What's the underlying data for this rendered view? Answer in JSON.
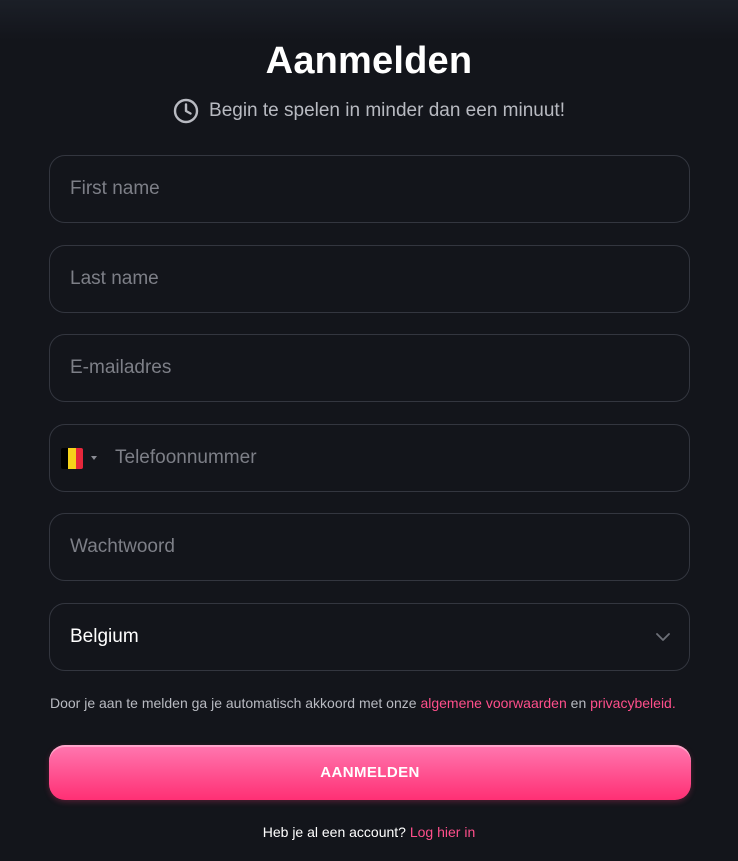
{
  "header": {
    "title": "Aanmelden",
    "subtitle": "Begin te spelen in minder dan een minuut!",
    "subtitle_icon": "clock-icon"
  },
  "form": {
    "first_name": {
      "placeholder": "First name",
      "value": ""
    },
    "last_name": {
      "placeholder": "Last name",
      "value": ""
    },
    "email": {
      "placeholder": "E-mailadres",
      "value": ""
    },
    "phone": {
      "placeholder": "Telefoonnummer",
      "value": "",
      "country_flag": "belgium-flag-icon",
      "flag_colors": [
        "#000000",
        "#f6d21a",
        "#e6273b"
      ]
    },
    "password": {
      "placeholder": "Wachtwoord",
      "value": ""
    },
    "country": {
      "selected": "Belgium",
      "icon": "chevron-down-icon"
    }
  },
  "terms": {
    "prefix": "Door je aan te melden ga je automatisch akkoord met onze",
    "terms_link": "algemene voorwaarden",
    "conjunction": "en",
    "privacy_link": "privacybeleid",
    "suffix": "."
  },
  "submit": {
    "label": "AANMELDEN"
  },
  "login": {
    "prompt": "Heb je al een account?",
    "link": "Log hier in"
  },
  "colors": {
    "background": "#13151b",
    "accent": "#ff4f8b",
    "button_top": "#ff78b0",
    "button_bottom": "#ff2f74",
    "border": "#33363f",
    "muted_text": "#b8bac1",
    "placeholder": "#7d7f87"
  }
}
